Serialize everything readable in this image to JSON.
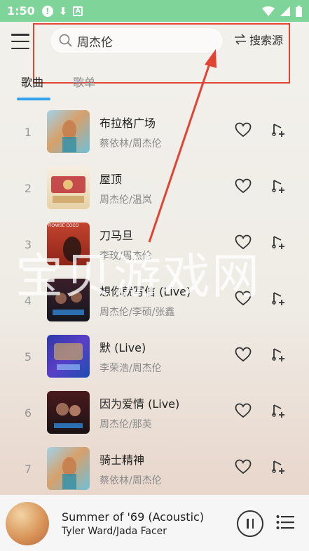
{
  "status_bar": {
    "time": "1:50"
  },
  "search": {
    "query": "周杰伦",
    "source_label": "搜索源"
  },
  "tabs": [
    {
      "label": "歌曲",
      "active": true
    },
    {
      "label": "歌单",
      "active": false
    }
  ],
  "songs": [
    {
      "index": "1",
      "title": "布拉格广场",
      "artist": "蔡依林/周杰伦"
    },
    {
      "index": "2",
      "title": "屋顶",
      "artist": "周杰伦/温岚"
    },
    {
      "index": "3",
      "title": "刀马旦",
      "artist": "李玟/周杰伦"
    },
    {
      "index": "4",
      "title": "想你就写信 (Live)",
      "artist": "周杰伦/李硕/张鑫"
    },
    {
      "index": "5",
      "title": "默 (Live)",
      "artist": "李荣浩/周杰伦"
    },
    {
      "index": "6",
      "title": "因为爱情 (Live)",
      "artist": "周杰伦/那英"
    },
    {
      "index": "7",
      "title": "骑士精神",
      "artist": "蔡依林/周杰伦"
    }
  ],
  "cover_labels": {
    "song3": "ROMISE COCO"
  },
  "now_playing": {
    "title": "Summer of '69 (Acoustic)",
    "artist": "Tyler Ward/Jada Facer"
  },
  "watermark": "宝贝游戏网",
  "colors": {
    "status_bar": "#7fd49a",
    "tab_indicator": "#33a3f0",
    "annotation": "#e24434"
  },
  "icons": [
    "menu-icon",
    "search-icon",
    "swap-icon",
    "heart-icon",
    "add-to-playlist-icon",
    "pause-icon",
    "playlist-icon"
  ]
}
